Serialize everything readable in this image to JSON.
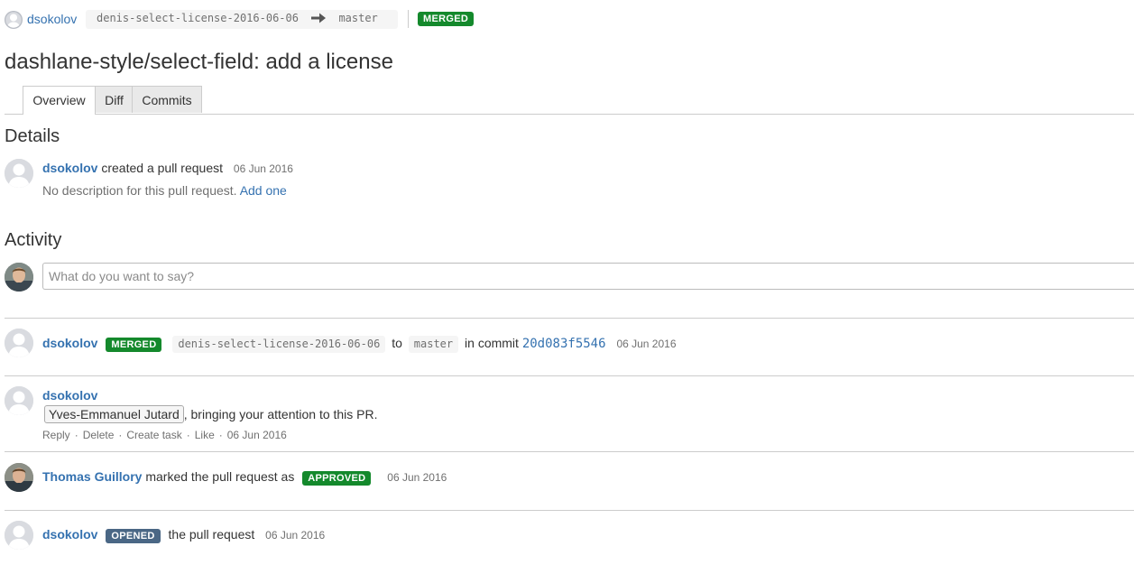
{
  "header": {
    "author": "dsokolov",
    "source_branch": "denis-select-license-2016-06-06",
    "target_branch": "master",
    "status": "MERGED",
    "title": "dashlane-style/select-field: add a license"
  },
  "tabs": [
    {
      "label": "Overview",
      "active": true
    },
    {
      "label": "Diff",
      "active": false
    },
    {
      "label": "Commits",
      "active": false
    }
  ],
  "details": {
    "heading": "Details",
    "author": "dsokolov",
    "action": "created a pull request",
    "date": "06 Jun 2016",
    "description": "No description for this pull request.",
    "add_link": "Add one"
  },
  "activity": {
    "heading": "Activity",
    "comment_placeholder": "What do you want to say?",
    "items": [
      {
        "author": "dsokolov",
        "badge": "MERGED",
        "source_branch": "denis-select-license-2016-06-06",
        "to": "to",
        "target_branch": "master",
        "in_commit": "in commit",
        "commit": "20d083f5546",
        "date": "06 Jun 2016"
      },
      {
        "author": "dsokolov",
        "mention": "Yves-Emmanuel Jutard",
        "text": ", bringing your attention to this PR.",
        "actions": [
          "Reply",
          "Delete",
          "Create task",
          "Like"
        ],
        "date": "06 Jun 2016"
      },
      {
        "author": "Thomas Guillory",
        "text": "marked the pull request as",
        "badge": "APPROVED",
        "date": "06 Jun 2016"
      },
      {
        "author": "dsokolov",
        "badge": "OPENED",
        "text": "the pull request",
        "date": "06 Jun 2016"
      }
    ]
  },
  "colors": {
    "link": "#3572b0",
    "merged": "#14892c",
    "approved": "#14892c",
    "opened": "#4a6785"
  },
  "icons": {
    "default_avatar": "person-silhouette-icon",
    "user_avatar": "user-photo-icon",
    "arrow": "right-arrow-icon"
  }
}
